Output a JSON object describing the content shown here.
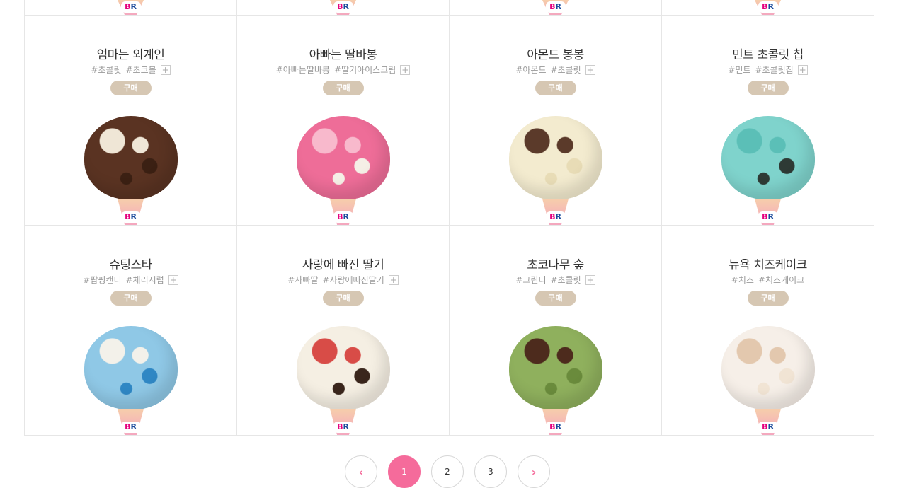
{
  "top_row_count": 4,
  "products": [
    {
      "name": "엄마는 외계인",
      "tags": [
        "#초콜릿",
        "#초코볼"
      ],
      "has_more": true,
      "buy": "구매",
      "colors": [
        "#5a3322",
        "#efe6d6",
        "#3b2013"
      ]
    },
    {
      "name": "아빠는 딸바봉",
      "tags": [
        "#아빠는딸바봉",
        "#딸기아이스크림"
      ],
      "has_more": true,
      "buy": "구매",
      "colors": [
        "#ee6d98",
        "#f8b9cc",
        "#f5efe6"
      ]
    },
    {
      "name": "아몬드 봉봉",
      "tags": [
        "#아몬드",
        "#초콜릿"
      ],
      "has_more": true,
      "buy": "구매",
      "colors": [
        "#f3ebcf",
        "#5b3a2a",
        "#e8dcb6"
      ]
    },
    {
      "name": "민트 초콜릿 칩",
      "tags": [
        "#민트",
        "#초콜릿칩"
      ],
      "has_more": true,
      "buy": "구매",
      "colors": [
        "#7fd3cc",
        "#5bbfb7",
        "#2e3a35"
      ]
    },
    {
      "name": "슈팅스타",
      "tags": [
        "#팝핑캔디",
        "#체리시럽"
      ],
      "has_more": true,
      "buy": "구매",
      "colors": [
        "#8fc8e6",
        "#f3f1ea",
        "#2f87c4"
      ]
    },
    {
      "name": "사랑에 빠진 딸기",
      "tags": [
        "#사빠딸",
        "#사랑에빠진딸기"
      ],
      "has_more": true,
      "buy": "구매",
      "colors": [
        "#f5efe3",
        "#d84c47",
        "#3a261c"
      ]
    },
    {
      "name": "초코나무 숲",
      "tags": [
        "#그린티",
        "#초콜릿"
      ],
      "has_more": true,
      "buy": "구매",
      "colors": [
        "#8fb05d",
        "#4d2b1d",
        "#6a8b3c"
      ]
    },
    {
      "name": "뉴욕 치즈케이크",
      "tags": [
        "#치즈",
        "#치즈케이크"
      ],
      "has_more": false,
      "buy": "구매",
      "colors": [
        "#f6efe8",
        "#e3c8ae",
        "#f1e4d4"
      ]
    }
  ],
  "cone_logo": {
    "b": "B",
    "r": "R"
  },
  "pagination": {
    "prev": "‹",
    "pages": [
      "1",
      "2",
      "3"
    ],
    "active": "1",
    "next": "›"
  }
}
